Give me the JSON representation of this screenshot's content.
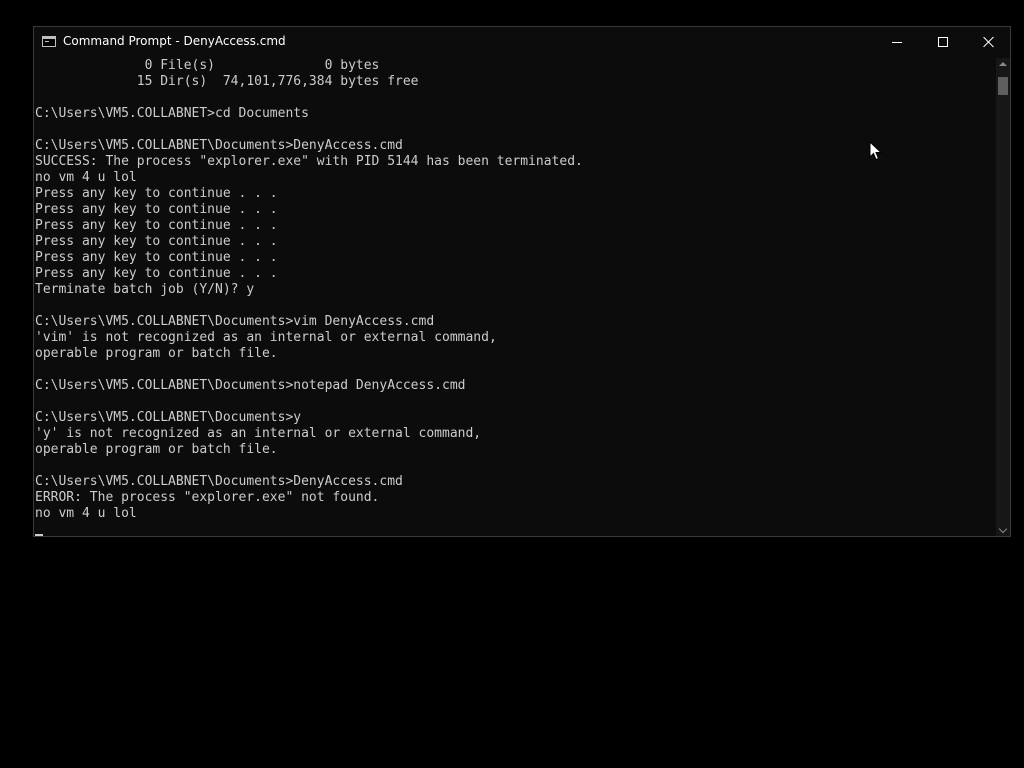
{
  "window": {
    "title": "Command Prompt - DenyAccess.cmd",
    "icon": "cmd-icon",
    "controls": {
      "minimize": "minimize-icon",
      "maximize": "maximize-icon",
      "close": "close-icon"
    }
  },
  "console": {
    "lines": [
      "              0 File(s)              0 bytes",
      "             15 Dir(s)  74,101,776,384 bytes free",
      "",
      "C:\\Users\\VM5.COLLABNET>cd Documents",
      "",
      "C:\\Users\\VM5.COLLABNET\\Documents>DenyAccess.cmd",
      "SUCCESS: The process \"explorer.exe\" with PID 5144 has been terminated.",
      "no vm 4 u lol",
      "Press any key to continue . . .",
      "Press any key to continue . . .",
      "Press any key to continue . . .",
      "Press any key to continue . . .",
      "Press any key to continue . . .",
      "Press any key to continue . . .",
      "Terminate batch job (Y/N)? y",
      "",
      "C:\\Users\\VM5.COLLABNET\\Documents>vim DenyAccess.cmd",
      "'vim' is not recognized as an internal or external command,",
      "operable program or batch file.",
      "",
      "C:\\Users\\VM5.COLLABNET\\Documents>notepad DenyAccess.cmd",
      "",
      "C:\\Users\\VM5.COLLABNET\\Documents>y",
      "'y' is not recognized as an internal or external command,",
      "operable program or batch file.",
      "",
      "C:\\Users\\VM5.COLLABNET\\Documents>DenyAccess.cmd",
      "ERROR: The process \"explorer.exe\" not found.",
      "no vm 4 u lol"
    ]
  },
  "scrollbar": {
    "up_icon": "scroll-up-arrow-icon",
    "down_icon": "scroll-down-arrow-icon"
  },
  "colors": {
    "desktop_background": "#000000",
    "console_background": "#0c0c0c",
    "console_text": "#cccccc",
    "title_text": "#ffffff"
  }
}
